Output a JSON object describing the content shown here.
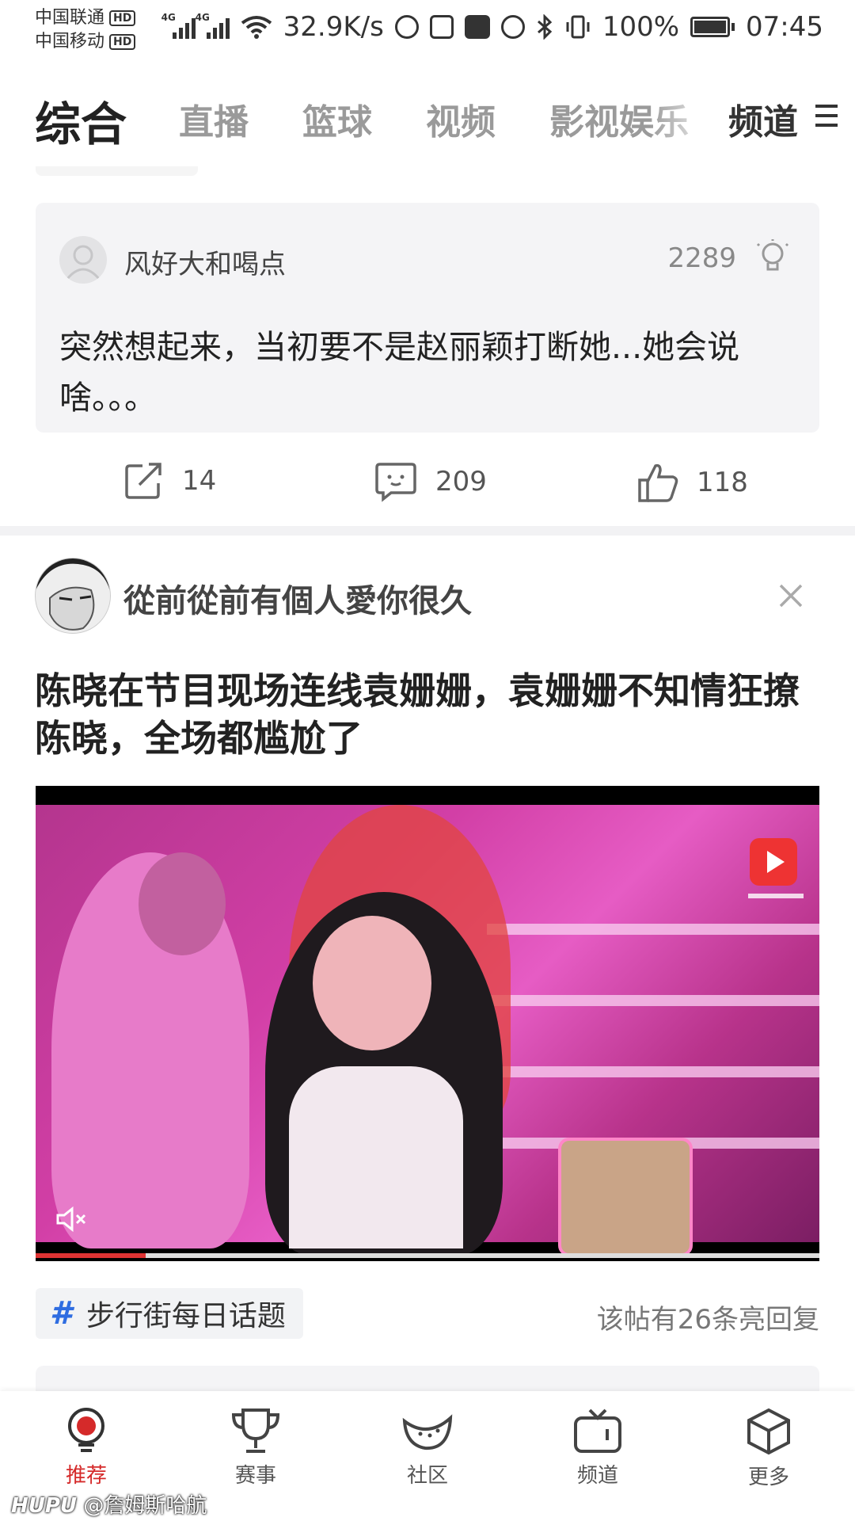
{
  "status_bar": {
    "carrier_1": "中国联通",
    "carrier_2": "中国移动",
    "hd_badge": "HD",
    "network_tag": "4G",
    "net_speed": "32.9K/s",
    "battery": "100%",
    "time": "07:45"
  },
  "tabs": {
    "items": [
      {
        "label": "综合"
      },
      {
        "label": "直播"
      },
      {
        "label": "篮球"
      },
      {
        "label": "视频"
      },
      {
        "label": "影视娱乐"
      }
    ],
    "channel_label": "频道"
  },
  "reply_card": {
    "username": "风好大和喝点",
    "light_count": "2289",
    "text": "突然想起来，当初要不是赵丽颖打断她...她会说啥。。。"
  },
  "actions": {
    "share_count": "14",
    "comment_count": "209",
    "like_count": "118"
  },
  "post": {
    "username": "從前從前有個人愛你很久",
    "title": "陈晓在节目现场连线袁姗姗，袁姗姗不知情狂撩陈晓，全场都尴尬了",
    "video": {
      "progress_fraction": 0.14,
      "muted": true
    }
  },
  "topic": {
    "label": "步行街每日话题",
    "reply_note": "该帖有26条亮回复"
  },
  "bottom_nav": {
    "items": [
      {
        "label": "推荐"
      },
      {
        "label": "赛事"
      },
      {
        "label": "社区"
      },
      {
        "label": "频道"
      },
      {
        "label": "更多"
      }
    ]
  },
  "watermark": {
    "brand": "HUPU",
    "handle": "@詹姆斯哈航"
  },
  "colors": {
    "accent_red": "#d52a2a",
    "topic_blue": "#2f6de1"
  }
}
